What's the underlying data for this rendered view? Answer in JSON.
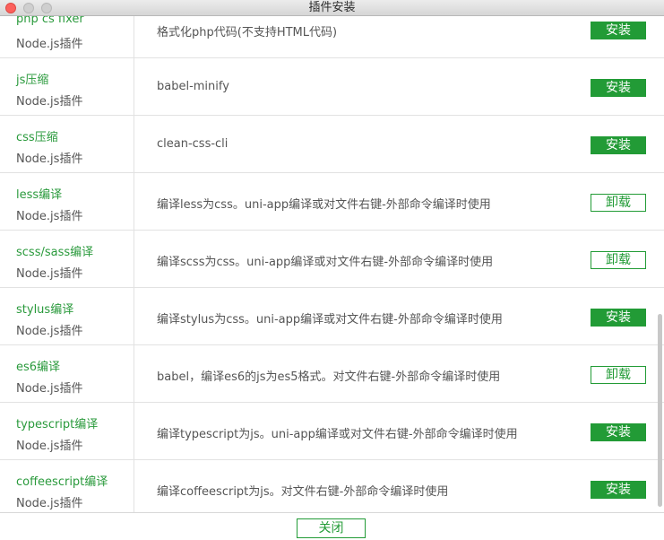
{
  "window": {
    "title": "插件安装"
  },
  "plugins": [
    {
      "name": "php cs fixer",
      "type": "Node.js插件",
      "description": "格式化php代码(不支持HTML代码)",
      "action": "安装",
      "installed": false
    },
    {
      "name": "js压缩",
      "type": "Node.js插件",
      "description": "babel-minify",
      "action": "安装",
      "installed": false
    },
    {
      "name": "css压缩",
      "type": "Node.js插件",
      "description": "clean-css-cli",
      "action": "安装",
      "installed": false
    },
    {
      "name": "less编译",
      "type": "Node.js插件",
      "description": "编译less为css。uni-app编译或对文件右键-外部命令编译时使用",
      "action": "卸载",
      "installed": true
    },
    {
      "name": "scss/sass编译",
      "type": "Node.js插件",
      "description": "编译scss为css。uni-app编译或对文件右键-外部命令编译时使用",
      "action": "卸载",
      "installed": true
    },
    {
      "name": "stylus编译",
      "type": "Node.js插件",
      "description": "编译stylus为css。uni-app编译或对文件右键-外部命令编译时使用",
      "action": "安装",
      "installed": false
    },
    {
      "name": "es6编译",
      "type": "Node.js插件",
      "description": "babel，编译es6的js为es5格式。对文件右键-外部命令编译时使用",
      "action": "卸载",
      "installed": true
    },
    {
      "name": "typescript编译",
      "type": "Node.js插件",
      "description": "编译typescript为js。uni-app编译或对文件右键-外部命令编译时使用",
      "action": "安装",
      "installed": false
    },
    {
      "name": "coffeescript编译",
      "type": "Node.js插件",
      "description": "编译coffeescript为js。对文件右键-外部命令编译时使用",
      "action": "安装",
      "installed": false
    }
  ],
  "footer": {
    "close_label": "关闭"
  },
  "colors": {
    "accent": "#229b36",
    "name_text": "#2a9a3c",
    "close_dot": "#fc605c"
  }
}
